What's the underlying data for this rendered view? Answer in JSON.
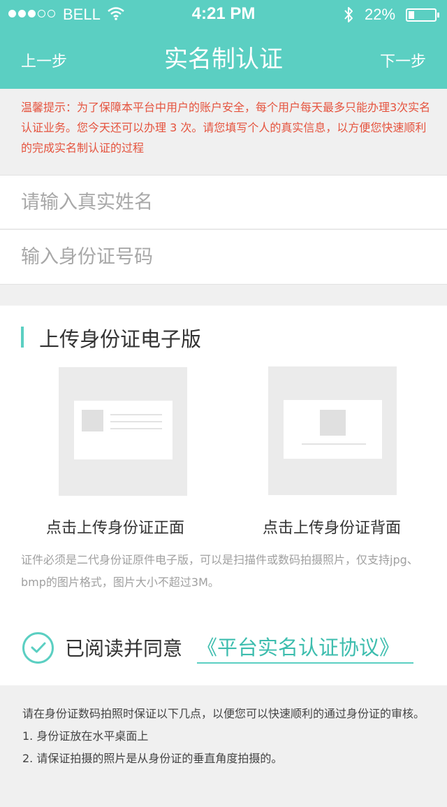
{
  "status_bar": {
    "carrier": "BELL",
    "time": "4:21 PM",
    "battery_percent": "22%",
    "battery_level": 0.22,
    "signal_bars_filled": 3,
    "signal_bars_total": 5,
    "icons": [
      "wifi-icon",
      "bluetooth-icon",
      "battery-icon"
    ]
  },
  "nav": {
    "prev_label": "上一步",
    "title": "实名制认证",
    "next_label": "下一步"
  },
  "notice": {
    "text": "温馨提示：为了保障本平台中用户的账户安全，每个用户每天最多只能办理3次实名认证业务。您今天还可以办理 3 次。请您填写个人的真实信息，以方便您快速顺利的完成实名制认证的过程"
  },
  "form": {
    "name_placeholder": "请输入真实姓名",
    "name_value": "",
    "id_placeholder": "输入身份证号码",
    "id_value": ""
  },
  "upload": {
    "section_title": "上传身份证电子版",
    "front_label": "点击上传身份证正面",
    "back_label": "点击上传身份证背面",
    "note": "证件必须是二代身份证原件电子版，可以是扫描件或数码拍摄照片，仅支持jpg、bmp的图片格式，图片大小不超过3M。"
  },
  "agreement": {
    "checked": true,
    "text": "已阅读并同意",
    "link_text": "《平台实名认证协议》"
  },
  "tips": {
    "intro": "请在身份证数码拍照时保证以下几点，以便您可以快速顺利的通过身份证的审核。",
    "items": [
      "1. 身份证放在水平桌面上",
      "2. 请保证拍摄的照片是从身份证的垂直角度拍摄的。"
    ]
  },
  "colors": {
    "accent": "#5bcfc2",
    "notice_text": "#e5543f",
    "background": "#f0f0f0",
    "placeholder": "#a8a8a8"
  }
}
